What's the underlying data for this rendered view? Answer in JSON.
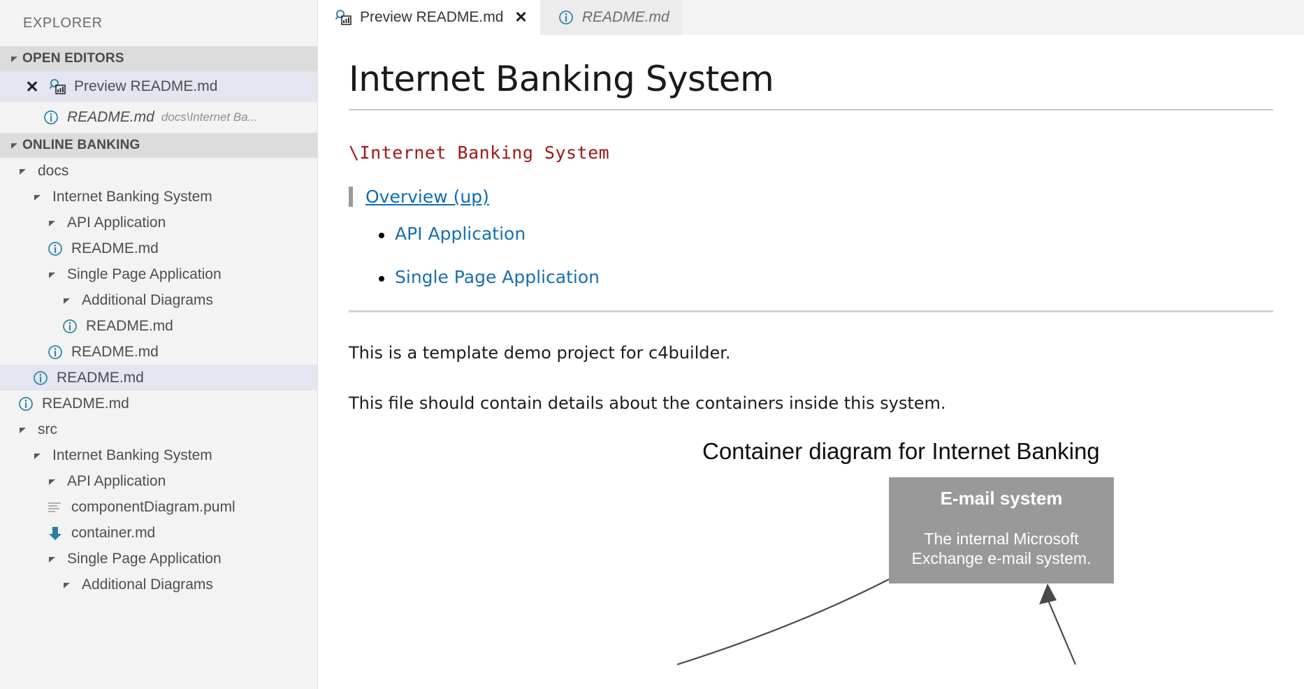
{
  "sidebar": {
    "title": "EXPLORER",
    "open_editors": {
      "label": "OPEN EDITORS",
      "items": [
        {
          "label": "Preview README.md",
          "icon": "preview-markdown-icon",
          "selected": true,
          "closable": true,
          "path": ""
        },
        {
          "label": "README.md",
          "icon": "info-icon",
          "selected": false,
          "closable": false,
          "path": "docs\\Internet Ba..."
        }
      ]
    },
    "workspace": {
      "label": "ONLINE BANKING",
      "tree": [
        {
          "label": "docs",
          "type": "folder",
          "depth": 1,
          "expanded": true,
          "selected": false
        },
        {
          "label": "Internet Banking System",
          "type": "folder",
          "depth": 2,
          "expanded": true,
          "selected": false
        },
        {
          "label": "API Application",
          "type": "folder",
          "depth": 3,
          "expanded": true,
          "selected": false
        },
        {
          "label": "README.md",
          "type": "file-md",
          "depth": 3,
          "expanded": false,
          "selected": false
        },
        {
          "label": "Single Page Application",
          "type": "folder",
          "depth": 3,
          "expanded": true,
          "selected": false
        },
        {
          "label": "Additional Diagrams",
          "type": "folder",
          "depth": 4,
          "expanded": true,
          "selected": false
        },
        {
          "label": "README.md",
          "type": "file-md",
          "depth": 4,
          "expanded": false,
          "selected": false
        },
        {
          "label": "README.md",
          "type": "file-md",
          "depth": 3,
          "expanded": false,
          "selected": false
        },
        {
          "label": "README.md",
          "type": "file-md",
          "depth": 2,
          "expanded": false,
          "selected": true
        },
        {
          "label": "README.md",
          "type": "file-md",
          "depth": 1,
          "expanded": false,
          "selected": false
        },
        {
          "label": "src",
          "type": "folder",
          "depth": 1,
          "expanded": true,
          "selected": false
        },
        {
          "label": "Internet Banking System",
          "type": "folder",
          "depth": 2,
          "expanded": true,
          "selected": false
        },
        {
          "label": "API Application",
          "type": "folder",
          "depth": 3,
          "expanded": true,
          "selected": false
        },
        {
          "label": "componentDiagram.puml",
          "type": "file-puml",
          "depth": 3,
          "expanded": false,
          "selected": false
        },
        {
          "label": "container.md",
          "type": "file-download",
          "depth": 3,
          "expanded": false,
          "selected": false
        },
        {
          "label": "Single Page Application",
          "type": "folder",
          "depth": 3,
          "expanded": true,
          "selected": false
        },
        {
          "label": "Additional Diagrams",
          "type": "folder",
          "depth": 4,
          "expanded": true,
          "selected": false
        }
      ]
    }
  },
  "tabs": [
    {
      "label": "Preview README.md",
      "icon": "preview-markdown-icon",
      "active": true,
      "close": "✕"
    },
    {
      "label": "README.md",
      "icon": "info-icon",
      "active": false,
      "close": ""
    }
  ],
  "preview": {
    "heading": "Internet Banking System",
    "inline_code": "\\Internet Banking System",
    "blockquote_link": "Overview (up)",
    "toc": [
      {
        "label": "API Application"
      },
      {
        "label": "Single Page Application"
      }
    ],
    "paragraphs": [
      "This is a template demo project for c4builder.",
      "This file should contain details about the containers inside this system."
    ],
    "diagram": {
      "title": "Container diagram for Internet Banking",
      "node": {
        "title": "E-mail system",
        "description_line1": "The internal Microsoft",
        "description_line2": "Exchange e-mail system."
      }
    }
  },
  "colors": {
    "selection": "#e3e5f1",
    "section_header": "#dcdcdc",
    "sidebar_bg": "#f3f3f3",
    "link": "#176fae",
    "code": "#a31515",
    "node_fill": "#999999",
    "icon_blue": "#2f86a8"
  }
}
